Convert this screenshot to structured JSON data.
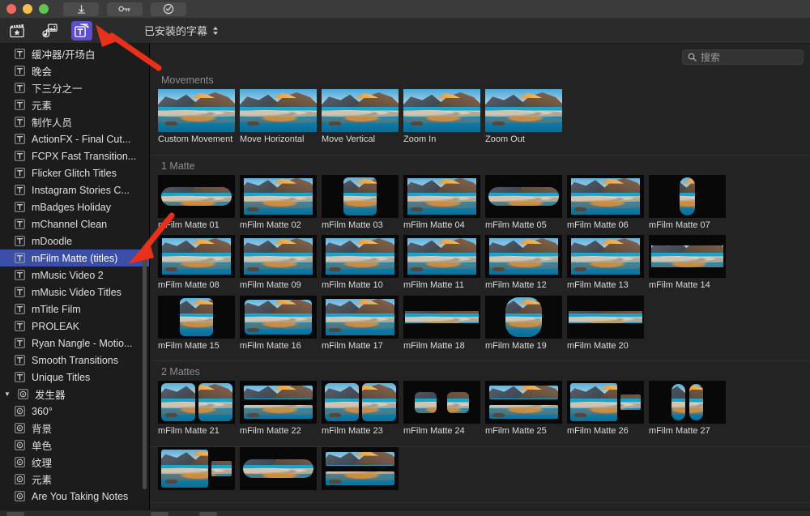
{
  "window": {
    "title": "",
    "traffic_lights": [
      "close",
      "minimize",
      "maximize"
    ],
    "titlebar_buttons": [
      {
        "name": "download-button",
        "icon": "download-arrow-icon"
      },
      {
        "name": "key-button",
        "icon": "key-icon"
      },
      {
        "name": "verify-button",
        "icon": "check-circle-icon"
      }
    ]
  },
  "toolbar": {
    "icons": [
      {
        "name": "effects-browser-icon",
        "icon": "clapperboard-star-icon",
        "active": false
      },
      {
        "name": "music-photos-browser-icon",
        "icon": "music-photo-icon",
        "active": false
      },
      {
        "name": "titles-generators-browser-icon",
        "icon": "titles-t-icon",
        "active": true,
        "accent": "#5b4fd0"
      }
    ],
    "dropdown": {
      "label": "已安装的字幕",
      "icon": "chevron-updown-icon"
    }
  },
  "search": {
    "placeholder": "搜索",
    "value": "",
    "icon": "search-icon"
  },
  "sidebar": {
    "selected_accent": "#3b4fa8",
    "items": [
      {
        "label": "缓冲器/开场白",
        "icon": "title-t-icon",
        "type": "item"
      },
      {
        "label": "晚会",
        "icon": "title-t-icon",
        "type": "item"
      },
      {
        "label": "下三分之一",
        "icon": "title-t-icon",
        "type": "item"
      },
      {
        "label": "元素",
        "icon": "title-t-icon",
        "type": "item"
      },
      {
        "label": "制作人员",
        "icon": "title-t-icon",
        "type": "item"
      },
      {
        "label": "ActionFX - Final Cut...",
        "icon": "title-t-icon",
        "type": "item"
      },
      {
        "label": "FCPX Fast Transition...",
        "icon": "title-t-icon",
        "type": "item"
      },
      {
        "label": "Flicker Glitch Titles",
        "icon": "title-t-icon",
        "type": "item"
      },
      {
        "label": "Instagram Stories C...",
        "icon": "title-t-icon",
        "type": "item"
      },
      {
        "label": "mBadges Holiday",
        "icon": "title-t-icon",
        "type": "item"
      },
      {
        "label": "mChannel Clean",
        "icon": "title-t-icon",
        "type": "item"
      },
      {
        "label": "mDoodle",
        "icon": "title-t-icon",
        "type": "item"
      },
      {
        "label": "mFilm Matte (titles)",
        "icon": "title-t-icon",
        "type": "item",
        "selected": true
      },
      {
        "label": "mMusic Video 2",
        "icon": "title-t-icon",
        "type": "item"
      },
      {
        "label": "mMusic Video Titles",
        "icon": "title-t-icon",
        "type": "item"
      },
      {
        "label": "mTitle Film",
        "icon": "title-t-icon",
        "type": "item"
      },
      {
        "label": "PROLEAK",
        "icon": "title-t-icon",
        "type": "item"
      },
      {
        "label": "Ryan Nangle - Motio...",
        "icon": "title-t-icon",
        "type": "item"
      },
      {
        "label": "Smooth Transitions",
        "icon": "title-t-icon",
        "type": "item"
      },
      {
        "label": "Unique Titles",
        "icon": "title-t-icon",
        "type": "item"
      },
      {
        "label": "发生器",
        "icon": "generator-icon",
        "type": "group",
        "expanded": true
      },
      {
        "label": "360°",
        "icon": "generator-icon",
        "type": "item"
      },
      {
        "label": "背景",
        "icon": "generator-icon",
        "type": "item"
      },
      {
        "label": "单色",
        "icon": "generator-icon",
        "type": "item"
      },
      {
        "label": "纹理",
        "icon": "generator-icon",
        "type": "item"
      },
      {
        "label": "元素",
        "icon": "generator-icon",
        "type": "item"
      },
      {
        "label": "Are You Taking Notes",
        "icon": "generator-icon",
        "type": "item"
      }
    ]
  },
  "browser": {
    "sections": [
      {
        "title": "Movements",
        "items": [
          {
            "label": "Custom Movement",
            "mask": "full"
          },
          {
            "label": "Move Horizontal",
            "mask": "full"
          },
          {
            "label": "Move Vertical",
            "mask": "full"
          },
          {
            "label": "Zoom In",
            "mask": "full"
          },
          {
            "label": "Zoom Out",
            "mask": "full"
          }
        ]
      },
      {
        "title": "1 Matte",
        "items": [
          {
            "label": "mFilm Matte 01",
            "mask": "wide-pill"
          },
          {
            "label": "mFilm Matte 02",
            "mask": "rect-wide"
          },
          {
            "label": "mFilm Matte 03",
            "mask": "square-round"
          },
          {
            "label": "mFilm Matte 04",
            "mask": "rect-wide"
          },
          {
            "label": "mFilm Matte 05",
            "mask": "wide-pill"
          },
          {
            "label": "mFilm Matte 06",
            "mask": "rect-wide"
          },
          {
            "label": "mFilm Matte 07",
            "mask": "tall-pill"
          },
          {
            "label": "mFilm Matte 08",
            "mask": "rect-wide"
          },
          {
            "label": "mFilm Matte 09",
            "mask": "rect-wide"
          },
          {
            "label": "mFilm Matte 10",
            "mask": "rect-wide"
          },
          {
            "label": "mFilm Matte 11",
            "mask": "rect-wide"
          },
          {
            "label": "mFilm Matte 12",
            "mask": "rect-wide"
          },
          {
            "label": "mFilm Matte 13",
            "mask": "rect-wide"
          },
          {
            "label": "mFilm Matte 14",
            "mask": "band"
          },
          {
            "label": "mFilm Matte 15",
            "mask": "square-round"
          },
          {
            "label": "mFilm Matte 16",
            "mask": "rect-round"
          },
          {
            "label": "mFilm Matte 17",
            "mask": "rect-wide"
          },
          {
            "label": "mFilm Matte 18",
            "mask": "thin-band"
          },
          {
            "label": "mFilm Matte 19",
            "mask": "squircle"
          },
          {
            "label": "mFilm Matte 20",
            "mask": "thin-band"
          }
        ]
      },
      {
        "title": "2 Mattes",
        "items": [
          {
            "label": "mFilm Matte 21",
            "mask": "two-squares"
          },
          {
            "label": "mFilm Matte 22",
            "mask": "two-bands"
          },
          {
            "label": "mFilm Matte 23",
            "mask": "two-squares"
          },
          {
            "label": "mFilm Matte 24",
            "mask": "two-small-squares"
          },
          {
            "label": "mFilm Matte 25",
            "mask": "two-bands"
          },
          {
            "label": "mFilm Matte 26",
            "mask": "big-small"
          },
          {
            "label": "mFilm Matte 27",
            "mask": "two-tall-pills"
          }
        ]
      },
      {
        "title": "",
        "items": [
          {
            "label": "",
            "mask": "big-small"
          },
          {
            "label": "",
            "mask": "wide-pill"
          },
          {
            "label": "",
            "mask": "two-bands"
          }
        ]
      }
    ]
  },
  "annotations": [
    {
      "name": "arrow-to-titles-icon",
      "color": "#e8301a"
    },
    {
      "name": "arrow-to-selected-sidebar-item",
      "color": "#e8301a"
    }
  ]
}
